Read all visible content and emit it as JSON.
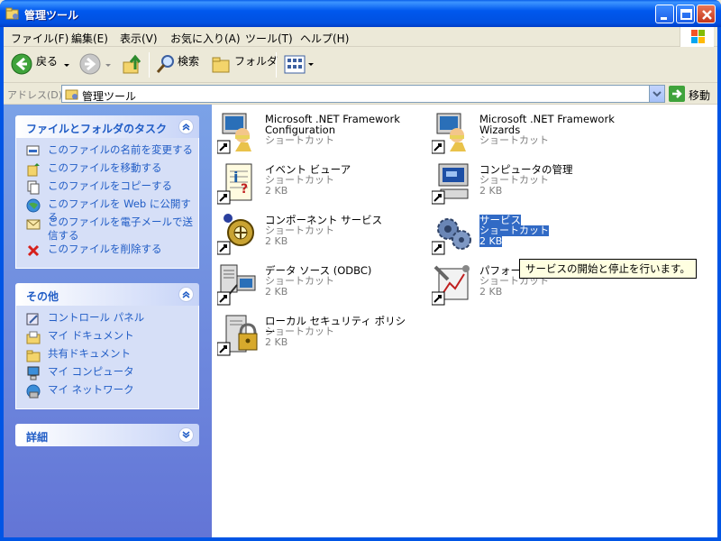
{
  "window": {
    "title": "管理ツール"
  },
  "menu": [
    "ファイル(F)",
    "編集(E)",
    "表示(V)",
    "お気に入り(A)",
    "ツール(T)",
    "ヘルプ(H)"
  ],
  "toolbar": {
    "back": "戻る",
    "search": "検索",
    "folders": "フォルダ"
  },
  "address": {
    "label": "アドレス(D)",
    "value": "管理ツール",
    "go": "移動"
  },
  "sidebar": {
    "tasks_title": "ファイルとフォルダのタスク",
    "tasks": [
      "このファイルの名前を変更する",
      "このファイルを移動する",
      "このファイルをコピーする",
      "このファイルを Web に公開する",
      "このファイルを電子メールで送信する",
      "このファイルを削除する"
    ],
    "other_title": "その他",
    "other": [
      "コントロール パネル",
      "マイ ドキュメント",
      "共有ドキュメント",
      "マイ コンピュータ",
      "マイ ネットワーク"
    ],
    "details_title": "詳細"
  },
  "items": [
    {
      "name1": "Microsoft .NET Framework",
      "name2": "Configuration",
      "type": "ショートカット",
      "size": ""
    },
    {
      "name1": "Microsoft .NET Framework",
      "name2": "Wizards",
      "type": "ショートカット",
      "size": ""
    },
    {
      "name1": "イベント ビューア",
      "name2": "",
      "type": "ショートカット",
      "size": "2 KB"
    },
    {
      "name1": "コンピュータの管理",
      "name2": "",
      "type": "ショートカット",
      "size": "2 KB"
    },
    {
      "name1": "コンポーネント サービス",
      "name2": "",
      "type": "ショートカット",
      "size": "2 KB"
    },
    {
      "name1": "サービス",
      "name2": "",
      "type": "ショートカット",
      "size": "2 KB"
    },
    {
      "name1": "データ ソース (ODBC)",
      "name2": "",
      "type": "ショートカット",
      "size": "2 KB"
    },
    {
      "name1": "パフォーマ",
      "name2": "",
      "type": "ショートカット",
      "size": "2 KB"
    },
    {
      "name1": "ローカル セキュリティ ポリシー",
      "name2": "",
      "type": "ショートカット",
      "size": "2 KB"
    }
  ],
  "tooltip": "サービスの開始と停止を行います。"
}
